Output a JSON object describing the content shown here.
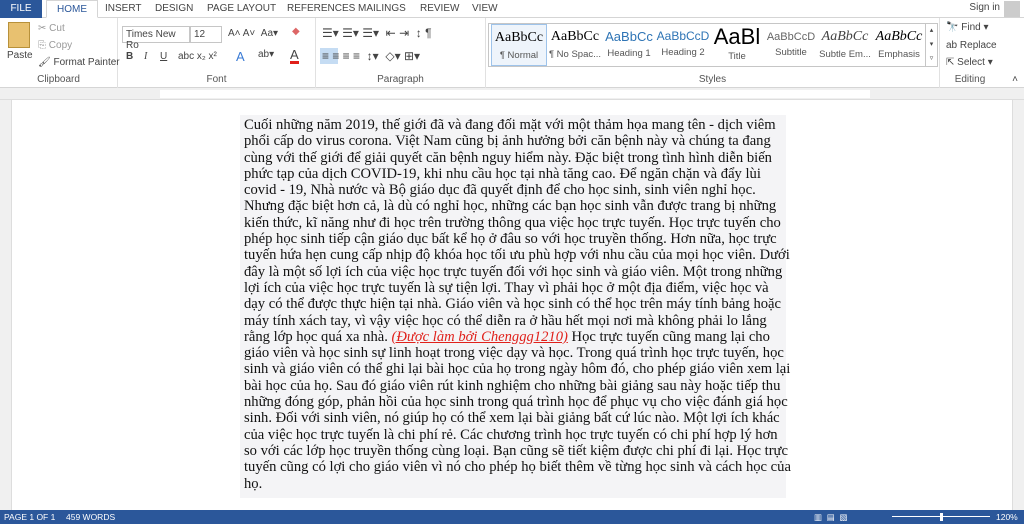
{
  "tabs": {
    "file": "FILE",
    "home": "HOME",
    "insert": "INSERT",
    "design": "DESIGN",
    "page_layout": "PAGE LAYOUT",
    "references": "REFERENCES",
    "mailings": "MAILINGS",
    "review": "REVIEW",
    "view": "VIEW"
  },
  "signin": "Sign in",
  "clipboard": {
    "paste": "Paste",
    "cut": "Cut",
    "copy": "Copy",
    "format_painter": "Format Painter",
    "label": "Clipboard"
  },
  "font": {
    "name": "Times New Ro",
    "size": "12",
    "label": "Font",
    "bold": "B",
    "italic": "I",
    "underline": "U",
    "color": "#e0201a"
  },
  "paragraph": {
    "label": "Paragraph"
  },
  "styles": {
    "label": "Styles",
    "items": [
      {
        "preview": "AaBbCc",
        "name": "¶ Normal"
      },
      {
        "preview": "AaBbCc",
        "name": "¶ No Spac..."
      },
      {
        "preview": "AaBbCc",
        "name": "Heading 1"
      },
      {
        "preview": "AaBbCcD",
        "name": "Heading 2"
      },
      {
        "preview": "AaBl",
        "name": "Title"
      },
      {
        "preview": "AaBbCcD",
        "name": "Subtitle"
      },
      {
        "preview": "AaBbCc",
        "name": "Subtle Em..."
      },
      {
        "preview": "AaBbCc",
        "name": "Emphasis"
      }
    ]
  },
  "editing": {
    "find": "Find",
    "replace": "Replace",
    "select": "Select",
    "label": "Editing"
  },
  "document": {
    "lines": [
      "Cuối những năm 2019, thế giới đã và đang đối mặt với một thảm họa mang tên - dịch viêm",
      "phổi cấp do virus corona. Việt Nam cũng bị ảnh hưởng bởi căn bệnh này và chúng ta đang",
      "cùng với thế giới để giải quyết căn bệnh nguy hiểm này. Đặc biệt trong tình hình diễn biến",
      "phức tạp của dịch COVID-19, khi nhu cầu học tại nhà tăng cao. Để ngăn chặn và đẩy lùi",
      "covid - 19, Nhà nước và Bộ giáo dục đã quyết định để cho học sinh, sinh viên nghỉ học.",
      "Nhưng đặc biệt hơn cả, là dù có nghỉ học, những các bạn học sinh vẫn được trang bị những",
      "kiến thức, kĩ năng như đi học trên trường thông qua việc học trực tuyến. Học trực tuyến cho",
      "phép học sinh tiếp cận giáo dục bất kể họ ở đâu so với học truyền thống. Hơn nữa, học trực",
      "tuyến hứa hẹn cung cấp nhịp độ khóa học tối ưu phù hợp với nhu cầu của mọi học viên. Dưới",
      "đây là một số lợi ích của việc học trực tuyến đối với học sinh và giáo viên. Một trong những",
      "lợi ích của việc học trực tuyến là sự tiện lợi. Thay vì phải học ở một địa điểm, việc học và",
      "dạy có thể được thực hiện tại nhà. Giáo viên và học sinh có thể học trên máy tính bảng hoặc",
      "máy tính xách tay, vì vậy việc học có thể diễn ra ở hầu hết mọi nơi mà không phải lo lắng"
    ],
    "line14_before": "rằng lớp học quá xa nhà. ",
    "credit": "(Được làm bởi Chenggg1210)",
    "line14_after": " Học trực tuyến cũng mang lại cho",
    "lines_after": [
      "giáo viên và học sinh sự linh hoạt trong việc dạy và học. Trong quá trình học trực tuyến, học",
      "sinh và giáo viên có thể ghi lại bài học của họ trong ngày hôm đó, cho phép giáo viên xem lại",
      "bài học của họ. Sau đó giáo viên rút kinh nghiệm cho những bài giảng sau này hoặc tiếp thu",
      "những đóng góp, phản hồi của học sinh trong quá trình học để phục vụ cho việc đánh giá học",
      "sinh. Đối với sinh viên, nó giúp họ có thể xem lại bài giảng bất cứ lúc nào. Một lợi ích khác",
      "của việc học trực tuyến là chi phí rẻ. Các chương trình học trực tuyến có chi phí hợp lý hơn",
      "so với các lớp học truyền thống cùng loại. Bạn cũng sẽ tiết kiệm được chi phí đi lại. Học trực",
      "tuyến cũng có lợi cho giáo viên vì nó cho phép họ biết thêm về từng học sinh và cách học của",
      "họ."
    ]
  },
  "status": {
    "page": "PAGE 1 OF 1",
    "words": "459 WORDS",
    "zoom": "120%"
  }
}
